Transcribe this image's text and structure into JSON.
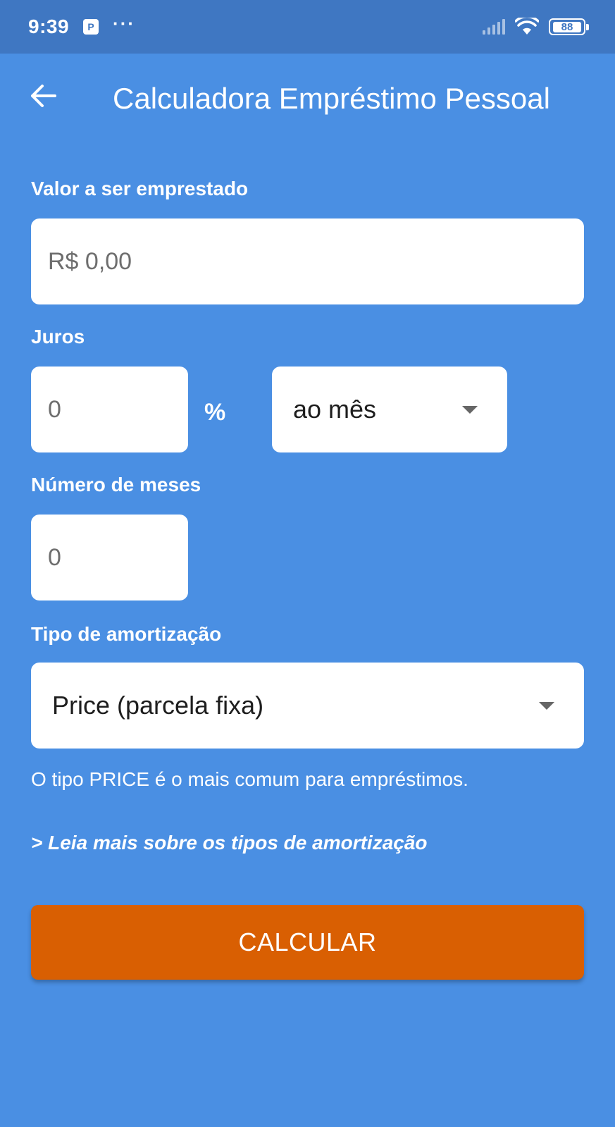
{
  "status_bar": {
    "time": "9:39",
    "notification_icon": "parking-app-icon",
    "more": "···",
    "battery": "88"
  },
  "app_bar": {
    "back_icon": "arrow-left-icon",
    "title": "Calculadora Empréstimo Pessoal"
  },
  "form": {
    "loan_amount": {
      "label": "Valor a ser emprestado",
      "placeholder": "R$ 0,00",
      "value": ""
    },
    "interest": {
      "label": "Juros",
      "placeholder": "0",
      "value": "",
      "unit": "%",
      "period_selected": "ao mês"
    },
    "months": {
      "label": "Número de meses",
      "placeholder": "0",
      "value": ""
    },
    "amortization": {
      "label": "Tipo de amortização",
      "selected": "Price (parcela fixa)",
      "helper": "O tipo PRICE é o mais comum para empréstimos.",
      "read_more": "> Leia mais sobre os tipos de amortização"
    },
    "submit_label": "CALCULAR"
  },
  "colors": {
    "background": "#4a8fe3",
    "status_bar": "#3f77c2",
    "button": "#d95f02",
    "field": "#ffffff"
  }
}
